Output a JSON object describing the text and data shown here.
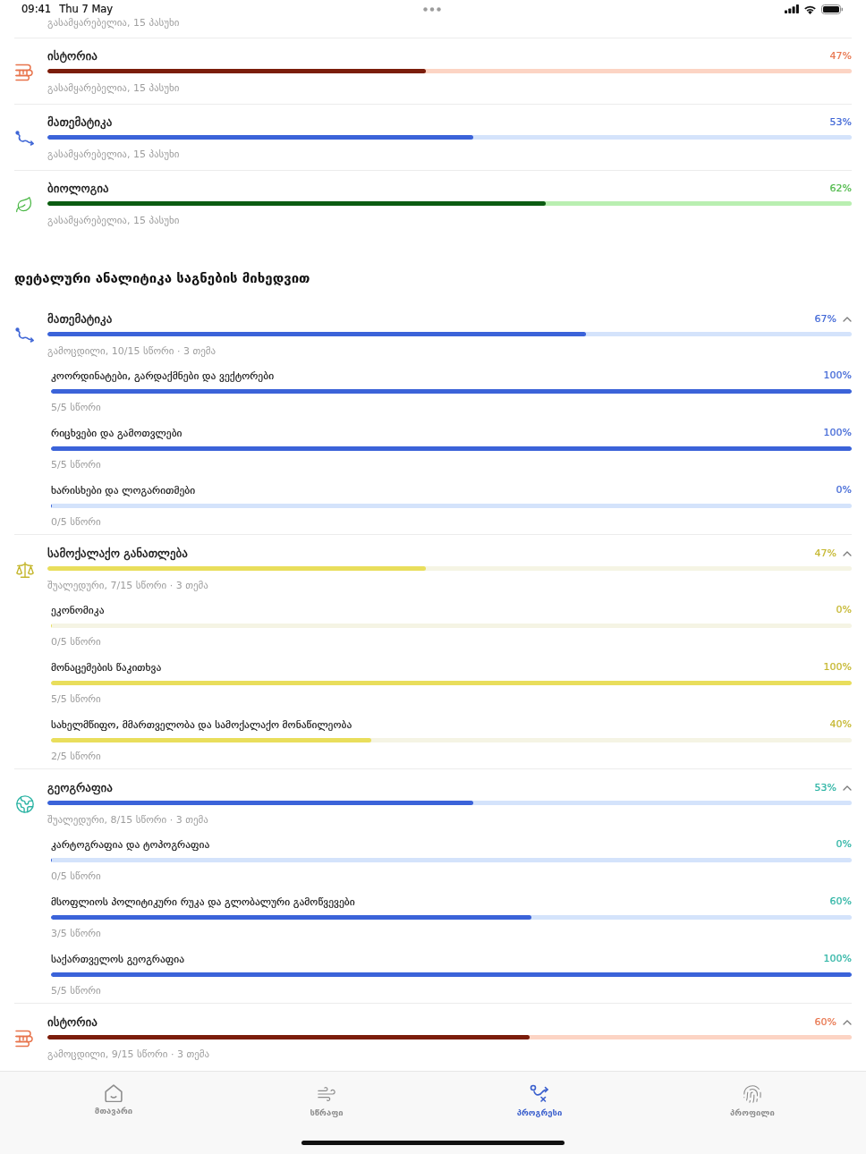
{
  "status_bar": {
    "time": "09:41",
    "date": "Thu 7 May"
  },
  "summary": {
    "previous_row_subtitle": "გასამყარებელია, 15 პასუხი",
    "subjects": [
      {
        "kind": "history",
        "color": "#e8744c",
        "title": "ისტორია",
        "percent": "47%",
        "level": 0.47,
        "subtitle": "გასამყარებელია, 15 პასუხი"
      },
      {
        "kind": "math",
        "color": "#3f66d6",
        "title": "მათემატიკა",
        "percent": "53%",
        "level": 0.53,
        "subtitle": "გასამყარებელია, 15 პასუხი"
      },
      {
        "kind": "biology",
        "color": "#4cb847",
        "title": "ბიოლოგია",
        "percent": "62%",
        "level": 0.62,
        "subtitle": "გასამყარებელია, 15 პასუხი"
      }
    ]
  },
  "analytics": {
    "title": "დეტალური ანალიტიკა საგნების მიხედვით",
    "subjects": [
      {
        "kind": "math",
        "color": "#3f66d6",
        "title": "მათემატიკა",
        "percent": "67%",
        "level": 0.67,
        "expanded": true,
        "subtitle": "გამოცდილი, 10/15 სწორი · 3 თემა",
        "topics": [
          {
            "title": "კოორდინატები, გარდაქმნები და ვექტორები",
            "percent": "100%",
            "level": 1,
            "subtitle": "5/5 სწორი"
          },
          {
            "title": "რიცხვები და გამოთვლები",
            "percent": "100%",
            "level": 1,
            "subtitle": "5/5 სწორი"
          },
          {
            "title": "ხარისხები და ლოგარითმები",
            "percent": "0%",
            "level": 0,
            "subtitle": "0/5 სწორი"
          }
        ]
      },
      {
        "kind": "civics",
        "color": "#c4b62c",
        "title": "სამოქალაქო განათლება",
        "percent": "47%",
        "level": 0.47,
        "expanded": true,
        "subtitle": "შუალედური, 7/15 სწორი · 3 თემა",
        "topics": [
          {
            "title": "ეკონომიკა",
            "percent": "0%",
            "level": 0,
            "subtitle": "0/5 სწორი"
          },
          {
            "title": "მონაცემების წაკითხვა",
            "percent": "100%",
            "level": 1,
            "subtitle": "5/5 სწორი"
          },
          {
            "title": "სახელმწიფო, მმართველობა და სამოქალაქო მონაწილეობა",
            "percent": "40%",
            "level": 0.4,
            "subtitle": "2/5 სწორი"
          }
        ]
      },
      {
        "kind": "geography",
        "color": "#2ab3a3",
        "title": "გეოგრაფია",
        "percent": "53%",
        "level": 0.53,
        "expanded": true,
        "subtitle": "შუალედური, 8/15 სწორი · 3 თემა",
        "topics": [
          {
            "title": "კარტოგრაფია და ტოპოგრაფია",
            "percent": "0%",
            "level": 0,
            "subtitle": "0/5 სწორი"
          },
          {
            "title": "მსოფლიოს პოლიტიკური რუკა და გლობალური გამოწვევები",
            "percent": "60%",
            "level": 0.6,
            "subtitle": "3/5 სწორი"
          },
          {
            "title": "საქართველოს გეოგრაფია",
            "percent": "100%",
            "level": 1,
            "subtitle": "5/5 სწორი"
          }
        ]
      },
      {
        "kind": "history",
        "color": "#e8744c",
        "title": "ისტორია",
        "percent": "60%",
        "level": 0.6,
        "expanded": true,
        "subtitle": "გამოცდილი, 9/15 სწორი · 3 თემა"
      }
    ]
  },
  "tab_bar": {
    "tabs": [
      {
        "kind": "home",
        "label": "მთავარი",
        "selected": false
      },
      {
        "kind": "fast",
        "label": "სწრაფი",
        "selected": false
      },
      {
        "kind": "progress",
        "label": "პროგრესი",
        "selected": true
      },
      {
        "kind": "profile",
        "label": "პროფილი",
        "selected": false
      }
    ]
  }
}
